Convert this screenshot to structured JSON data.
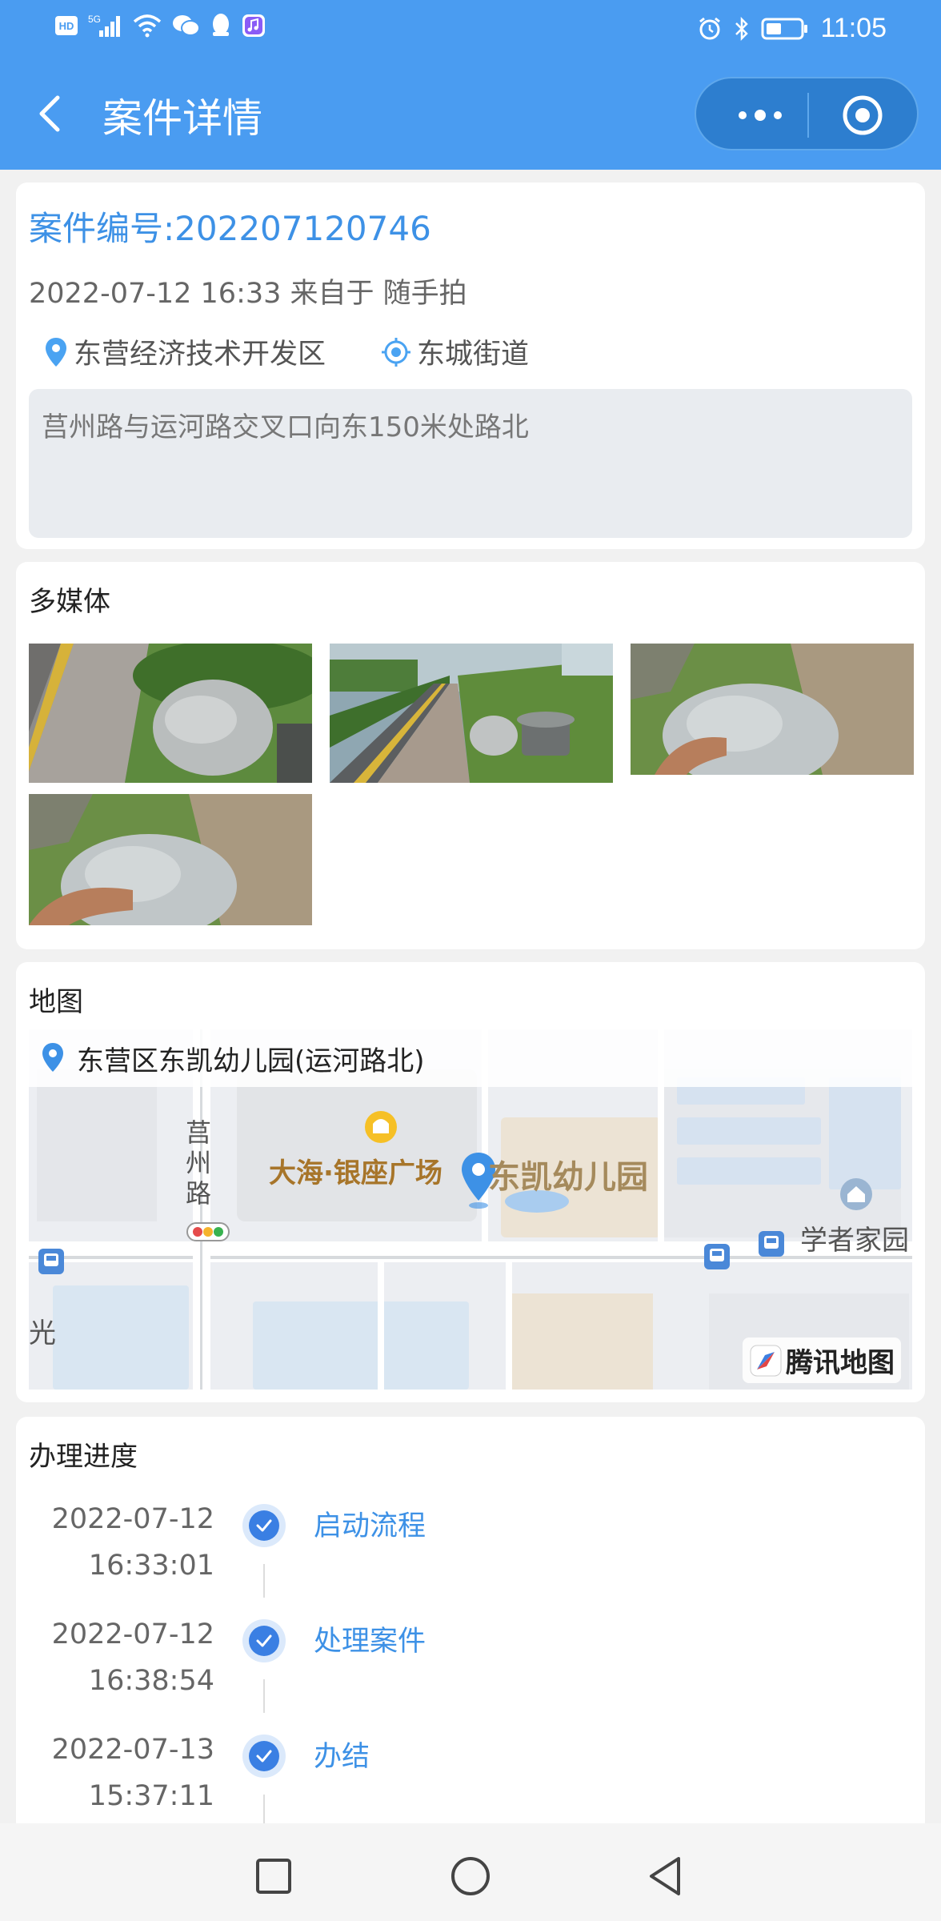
{
  "status_bar": {
    "left_icons": [
      "hd-icon",
      "signal-5g-icon",
      "wifi-icon",
      "wechat-icon",
      "qq-icon",
      "music-icon"
    ],
    "labels": {
      "hd": "HD",
      "net": "5G"
    },
    "right_icons": [
      "alarm-icon",
      "bluetooth-icon",
      "battery-icon"
    ],
    "time": "11:05"
  },
  "header": {
    "title": "案件详情",
    "back_icon": "chevron-left-icon",
    "more_icon": "more-dots-icon",
    "close_icon": "target-circle-icon",
    "bg_color": "#4a9cf1"
  },
  "case": {
    "number": "案件编号:202207120746",
    "meta": "2022-07-12 16:33 来自于 随手拍",
    "district": "东营经济技术开发区",
    "street": "东城街道",
    "address": "莒州路与运河路交叉口向东150米处路北"
  },
  "media": {
    "title": "多媒体",
    "photos": [
      "photo-1",
      "photo-2",
      "photo-3",
      "photo-4"
    ]
  },
  "map": {
    "title": "地图",
    "location": "东营区东凯幼儿园(运河路北)",
    "labels": {
      "road": "莒州路",
      "mall": "大海·银座广场",
      "kindergarten": "东凯幼儿园",
      "residence": "学者家园",
      "edge": "光"
    },
    "logo": "腾讯地图"
  },
  "progress": {
    "title": "办理进度",
    "steps": [
      {
        "date": "2022-07-12",
        "time": "16:33:01",
        "label": "启动流程"
      },
      {
        "date": "2022-07-12",
        "time": "16:38:54",
        "label": "处理案件"
      },
      {
        "date": "2022-07-13",
        "time": "15:37:11",
        "label": "办结"
      }
    ]
  },
  "system_nav": {
    "icons": [
      "square-recents-icon",
      "circle-home-icon",
      "triangle-back-icon"
    ]
  }
}
